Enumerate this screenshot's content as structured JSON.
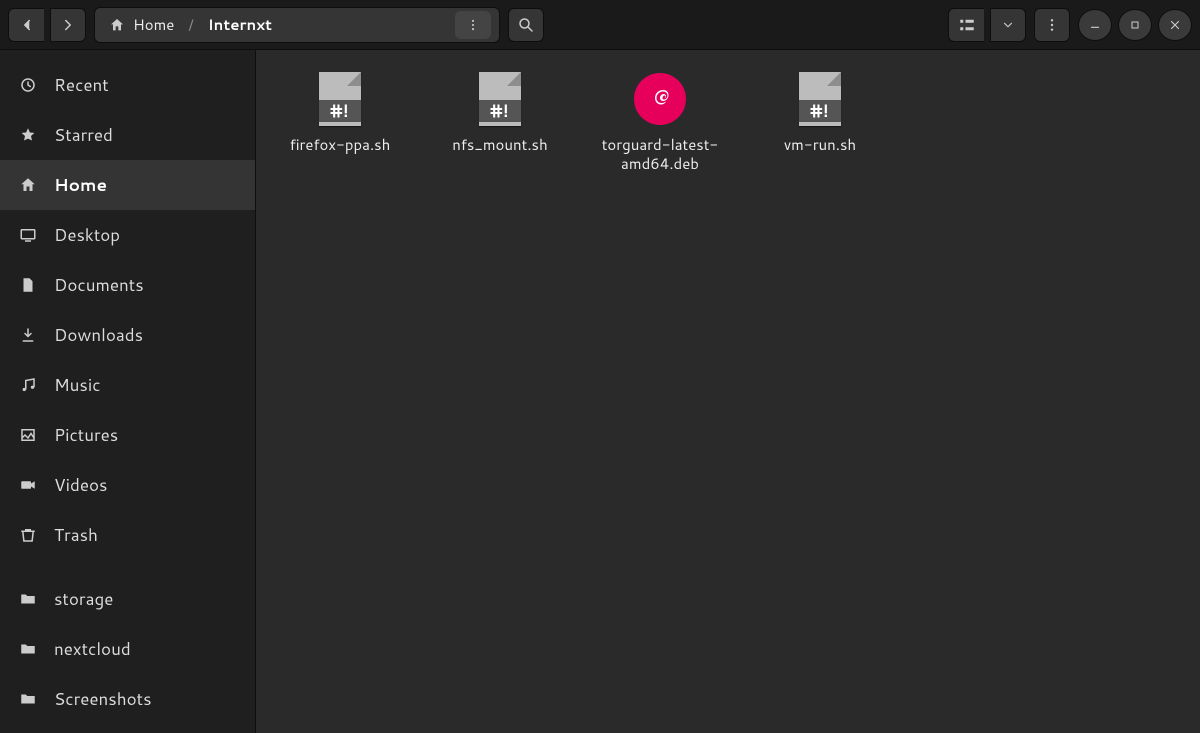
{
  "breadcrumb": {
    "home": "Home",
    "current": "Internxt"
  },
  "sidebar": {
    "items": [
      {
        "id": "recent",
        "label": "Recent",
        "icon": "clock"
      },
      {
        "id": "starred",
        "label": "Starred",
        "icon": "star"
      },
      {
        "id": "home",
        "label": "Home",
        "icon": "home",
        "active": true
      },
      {
        "id": "desktop",
        "label": "Desktop",
        "icon": "desktop"
      },
      {
        "id": "documents",
        "label": "Documents",
        "icon": "document"
      },
      {
        "id": "downloads",
        "label": "Downloads",
        "icon": "download"
      },
      {
        "id": "music",
        "label": "Music",
        "icon": "music"
      },
      {
        "id": "pictures",
        "label": "Pictures",
        "icon": "picture"
      },
      {
        "id": "videos",
        "label": "Videos",
        "icon": "video"
      },
      {
        "id": "trash",
        "label": "Trash",
        "icon": "trash"
      }
    ],
    "bookmarks": [
      {
        "id": "storage",
        "label": "storage",
        "icon": "folder"
      },
      {
        "id": "nextcloud",
        "label": "nextcloud",
        "icon": "folder"
      },
      {
        "id": "screenshots",
        "label": "Screenshots",
        "icon": "folder"
      }
    ]
  },
  "files": [
    {
      "name": "firefox-ppa.sh",
      "kind": "shell"
    },
    {
      "name": "nfs_mount.sh",
      "kind": "shell"
    },
    {
      "name": "torguard-latest-amd64.deb",
      "kind": "deb"
    },
    {
      "name": "vm-run.sh",
      "kind": "shell"
    }
  ],
  "icons": {
    "hashbang": "#!"
  }
}
